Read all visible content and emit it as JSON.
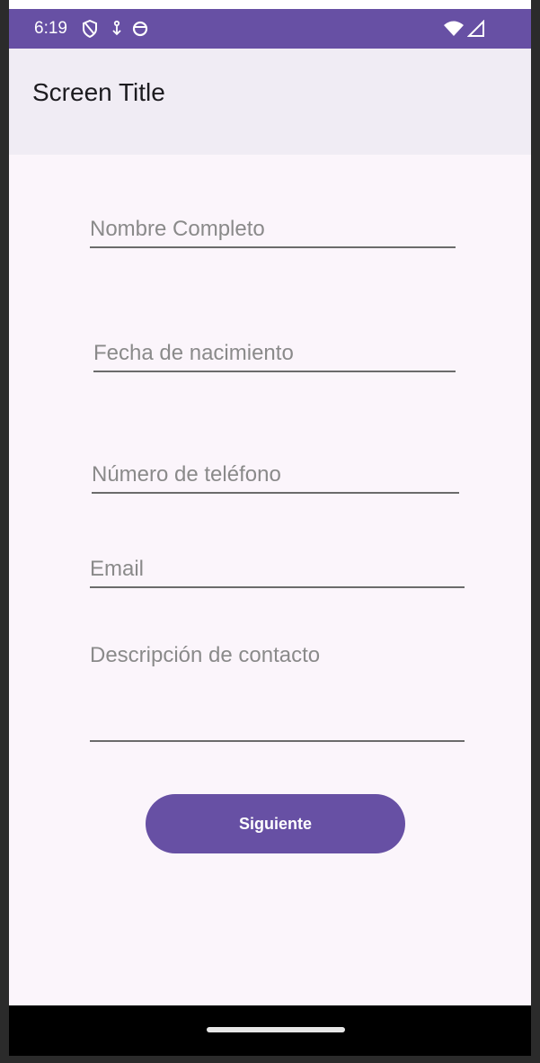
{
  "status_bar": {
    "time": "6:19",
    "left_icons": [
      "shield-icon",
      "download-icon",
      "sync-icon"
    ],
    "right_icons": [
      "wifi-icon",
      "signal-icon"
    ],
    "color": "#6750a4"
  },
  "app_bar": {
    "title": "Screen Title"
  },
  "form": {
    "full_name_placeholder": "Nombre Completo",
    "birth_date_placeholder": "Fecha de nacimiento",
    "phone_placeholder": "Número de teléfono",
    "email_placeholder": "Email",
    "description_placeholder": "Descripción de contacto"
  },
  "actions": {
    "next_label": "Siguiente"
  },
  "colors": {
    "accent": "#6750a4",
    "background": "#fbf5fb",
    "app_bar": "#f0ecf4"
  }
}
